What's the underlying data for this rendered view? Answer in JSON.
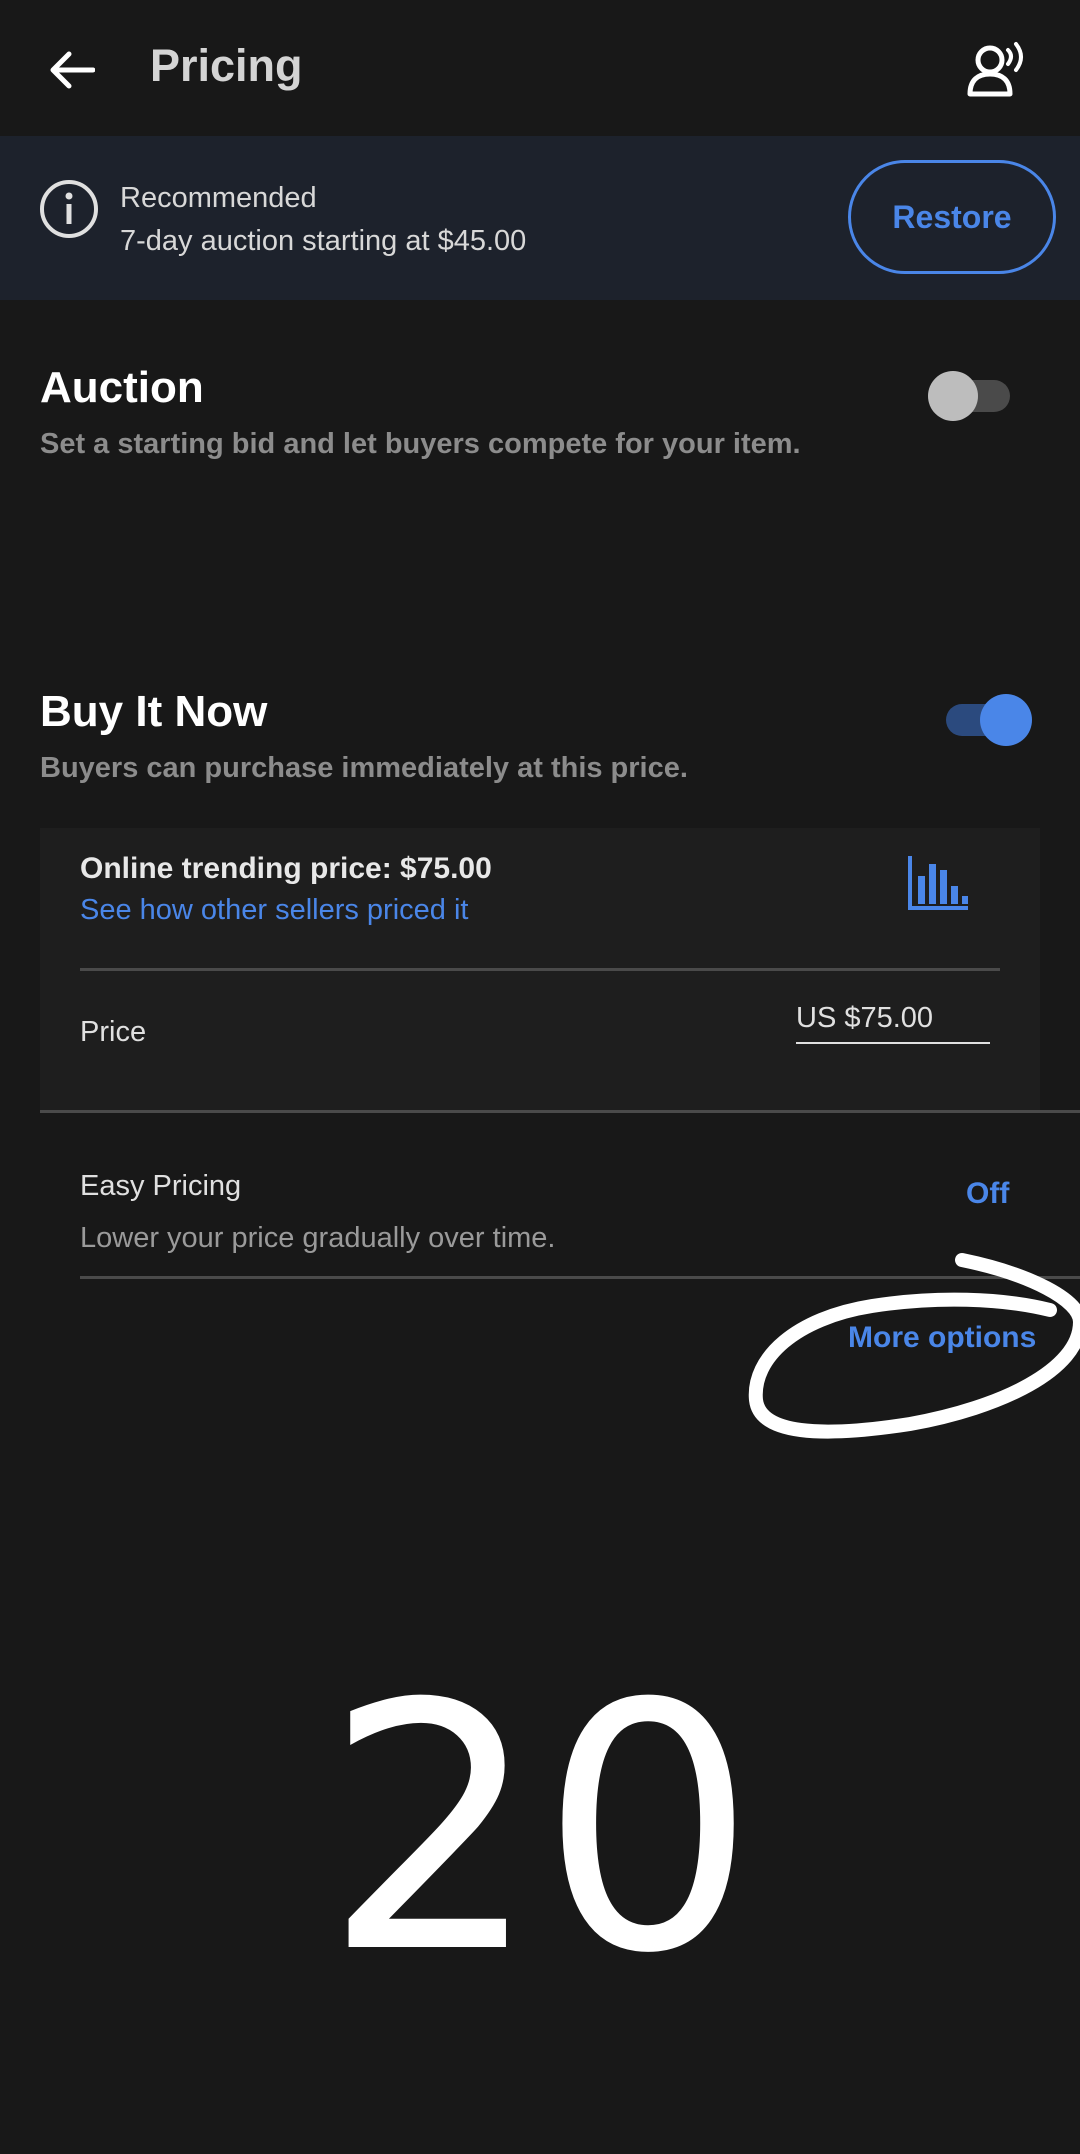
{
  "header": {
    "title": "Pricing",
    "back_icon": "arrow-left-icon",
    "support_icon": "voice-support-icon"
  },
  "banner": {
    "title": "Recommended",
    "subtitle": "7-day auction starting at $45.00",
    "restore_label": "Restore",
    "icon": "info-icon"
  },
  "auction": {
    "title": "Auction",
    "description": "Set a starting bid and let buyers compete for your item.",
    "enabled": false
  },
  "buy_it_now": {
    "title": "Buy It Now",
    "description": "Buyers can purchase immediately at this price.",
    "enabled": true
  },
  "trending": {
    "title": "Online trending price: $75.00",
    "link": "See how other sellers priced it",
    "icon": "bar-chart-icon"
  },
  "price": {
    "label": "Price",
    "value": "US $75.00"
  },
  "easy_pricing": {
    "label": "Easy Pricing",
    "description": "Lower your price gradually over time.",
    "value": "Off"
  },
  "more_options": "More options",
  "overlay_number": "20",
  "colors": {
    "accent": "#4a86e8",
    "background": "#181818",
    "banner": "#1d222c"
  }
}
